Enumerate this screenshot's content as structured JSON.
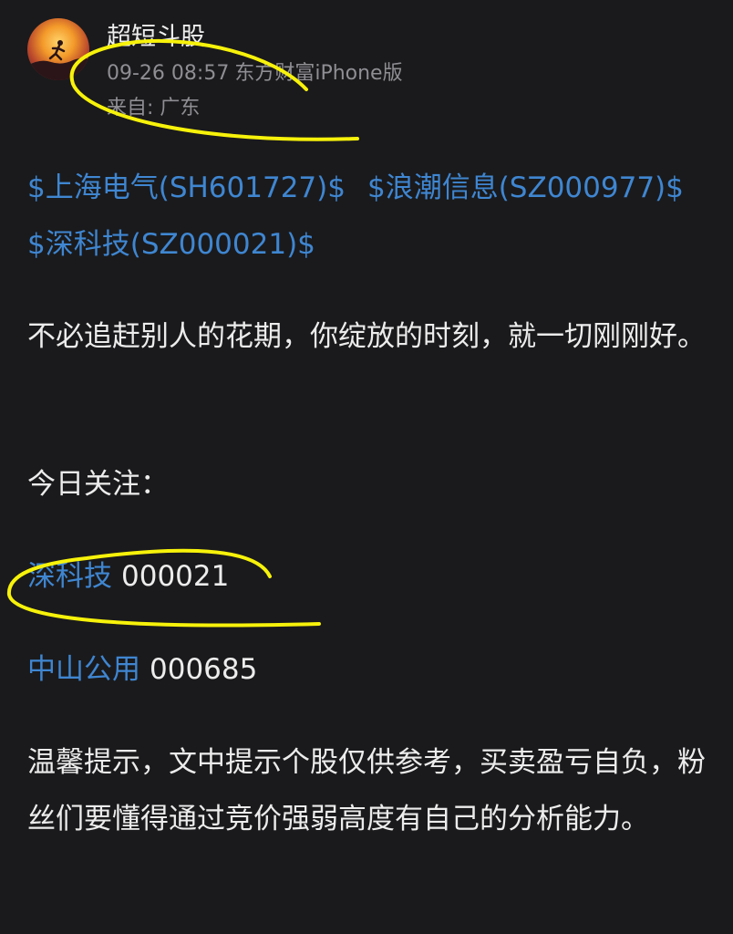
{
  "author": {
    "name": "超短斗股",
    "date": "09-26 08:57",
    "client": "东方财富iPhone版",
    "origin": "来自: 广东"
  },
  "post": {
    "tags": [
      "$上海电气(SH601727)$",
      "$浪潮信息(SZ000977)$",
      "$深科技(SZ000021)$"
    ],
    "quote": "不必追赶别人的花期，你绽放的时刻，就一切刚刚好。",
    "focus_heading": "今日关注：",
    "focus_stocks": [
      {
        "name": "深科技",
        "code": "000021"
      },
      {
        "name": "中山公用",
        "code": "000685"
      }
    ],
    "disclaimer": "温馨提示，文中提示个股仅供参考，买卖盈亏自负，粉丝们要懂得通过竞价强弱高度有自己的分析能力。"
  },
  "colors": {
    "background": "#1a1a1c",
    "text": "#ececec",
    "meta": "#8e8e93",
    "link": "#3f86d1",
    "annotation": "#f7f20a"
  }
}
